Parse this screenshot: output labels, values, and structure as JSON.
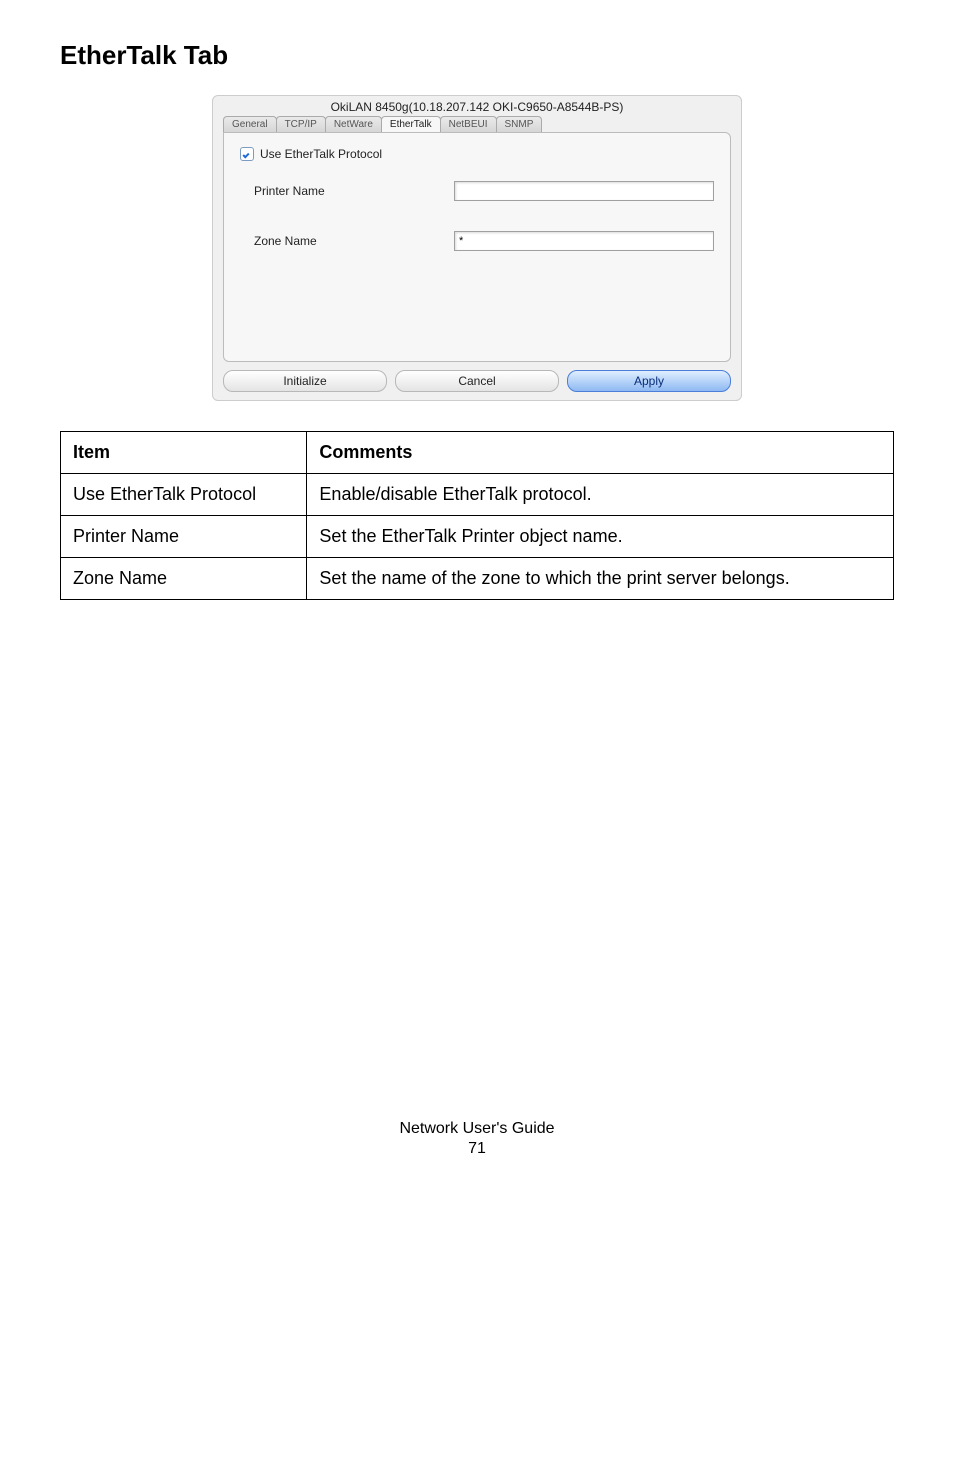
{
  "page": {
    "title": "EtherTalk Tab",
    "footer_title": "Network User's Guide",
    "footer_page": "71"
  },
  "dialog": {
    "title": "OkiLAN 8450g(10.18.207.142 OKI-C9650-A8544B-PS)",
    "tabs": {
      "general": "General",
      "tcpip": "TCP/IP",
      "netware": "NetWare",
      "ethertalk": "EtherTalk",
      "netbeui": "NetBEUI",
      "snmp": "SNMP"
    },
    "checkbox_label": "Use EtherTalk Protocol",
    "printer_name_label": "Printer Name",
    "printer_name_value": "",
    "zone_name_label": "Zone Name",
    "zone_name_value": "*",
    "buttons": {
      "initialize": "Initialize",
      "cancel": "Cancel",
      "apply": "Apply"
    }
  },
  "table": {
    "header_item": "Item",
    "header_comments": "Comments",
    "rows": [
      {
        "item": "Use EtherTalk Protocol",
        "comment": "Enable/disable EtherTalk protocol."
      },
      {
        "item": "Printer Name",
        "comment": "Set the EtherTalk Printer object name."
      },
      {
        "item": "Zone Name",
        "comment": "Set the name of the zone to which the print server belongs."
      }
    ]
  }
}
